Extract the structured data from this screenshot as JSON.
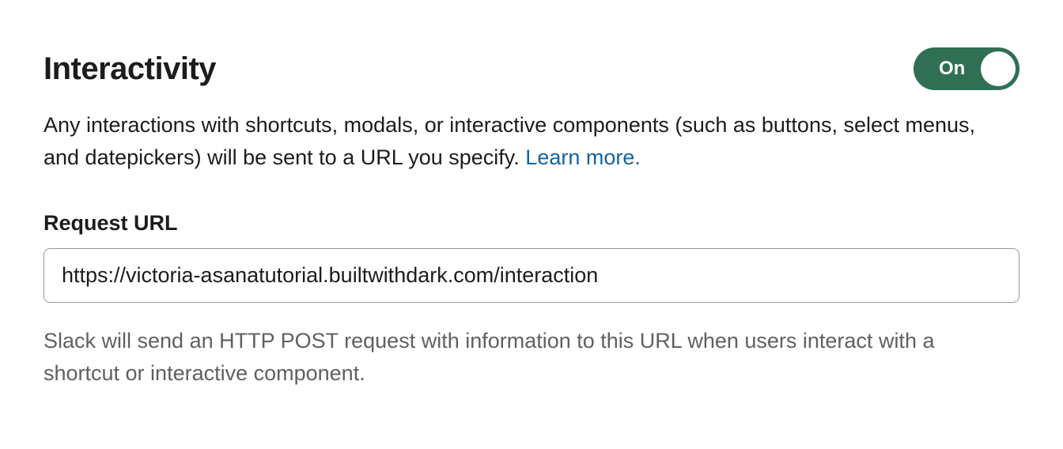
{
  "section": {
    "title": "Interactivity",
    "toggle": {
      "label": "On",
      "state": "on"
    },
    "description": "Any interactions with shortcuts, modals, or interactive components (such as buttons, select menus, and datepickers) will be sent to a URL you specify. ",
    "learn_more": "Learn more.",
    "request_url": {
      "label": "Request URL",
      "value": "https://victoria-asanatutorial.builtwithdark.com/interaction",
      "helper": "Slack will send an HTTP POST request with information to this URL when users interact with a shortcut or interactive component."
    }
  }
}
